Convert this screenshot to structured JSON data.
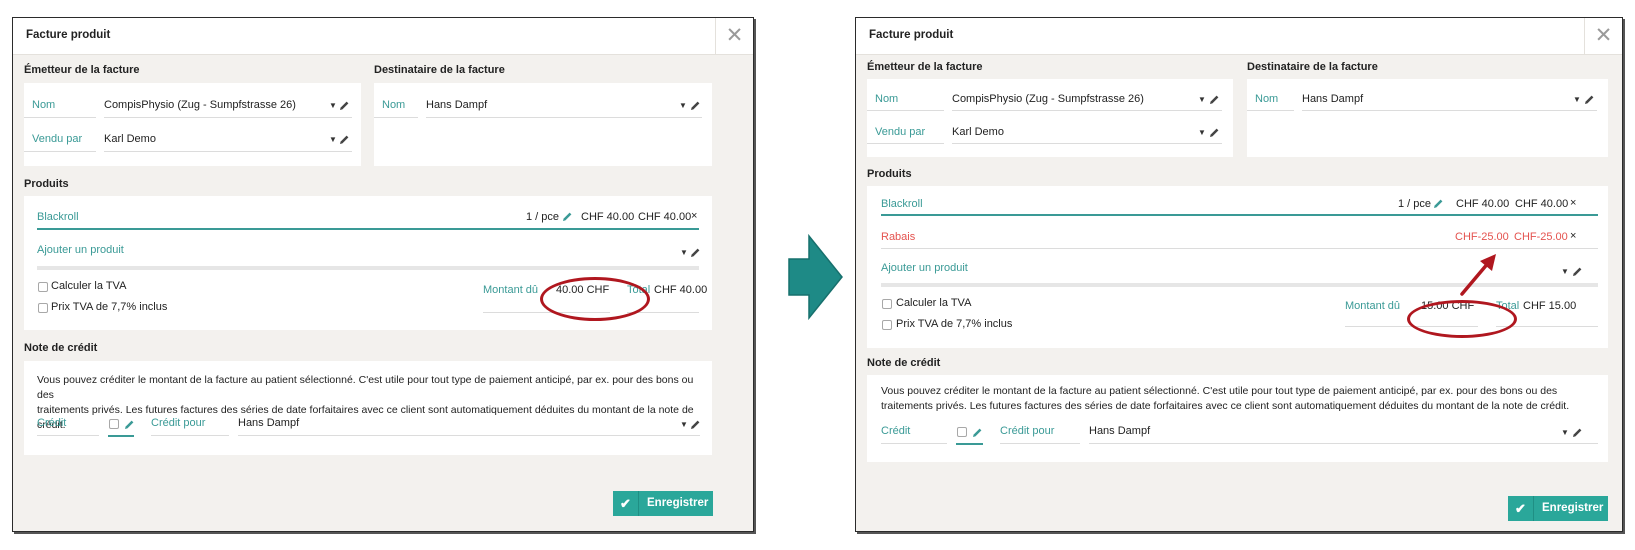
{
  "dialog_title": "Facture produit",
  "close_glyph": "✕",
  "sections": {
    "issuer": "Émetteur de la facture",
    "recipient": "Destinataire de la facture",
    "products": "Produits",
    "credit_note": "Note de crédit"
  },
  "issuer": {
    "name_label": "Nom",
    "name_value": "CompisPhysio (Zug - Sumpfstrasse 26)",
    "sold_by_label": "Vendu par",
    "sold_by_value": "Karl Demo"
  },
  "recipient": {
    "name_label": "Nom",
    "name_value": "Hans Dampf"
  },
  "product_row": {
    "name": "Blackroll",
    "qty": "1 / pce",
    "unit_price": "CHF 40.00",
    "line_total": "CHF 40.00",
    "remove": "×"
  },
  "discount_row": {
    "name": "Rabais",
    "unit_price": "CHF-25.00",
    "line_total": "CHF-25.00",
    "remove": "×"
  },
  "add_product": "Ajouter un produit",
  "vat": {
    "calc_label": "Calculer la TVA",
    "incl_label": "Prix TVA de 7,7% inclus"
  },
  "left_totals": {
    "amount_due_label": "Montant dû",
    "amount_due_value": "40.00 CHF",
    "total_label": "Total",
    "total_value": "CHF 40.00"
  },
  "right_totals": {
    "amount_due_label": "Montant dû",
    "amount_due_value": "15.00 CHF",
    "total_label": "Total",
    "total_value": "CHF 15.00"
  },
  "credit": {
    "note_line1": "Vous pouvez créditer le montant de la facture au patient sélectionné. C'est utile pour tout type de paiement anticipé, par ex. pour des bons ou des",
    "note_line2": "traitements privés. Les futures factures des séries de date forfaitaires avec ce client sont automatiquement déduites du montant de la note de crédit.",
    "credit_label": "Crédit",
    "credit_for_label": "Crédit pour",
    "credit_for_value": "Hans Dampf"
  },
  "save_button": "Enregistrer",
  "icons": {
    "check": "✔",
    "caret": "▼",
    "remove": "remove-icon",
    "edit": "pencil-icon"
  },
  "colors": {
    "accent": "#3a9a96",
    "save_button": "#2aa79a",
    "discount": "#e4534f",
    "annotation": "#b0171f",
    "transition_arrow": "#1e8a86"
  }
}
